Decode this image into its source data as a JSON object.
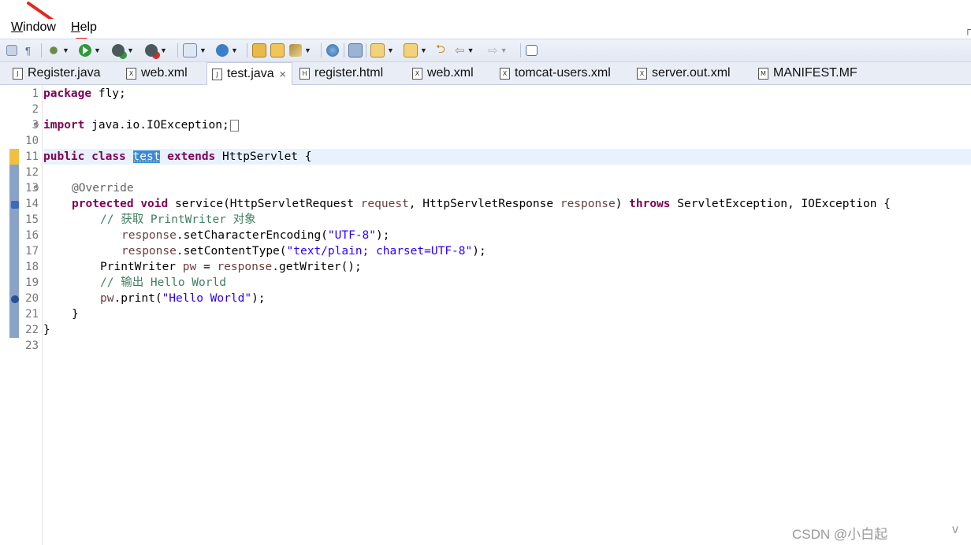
{
  "menubar": {
    "items": [
      {
        "label": "Window",
        "mnemonic": "W"
      },
      {
        "label": "Help",
        "mnemonic": "H"
      }
    ]
  },
  "toolbar": {
    "buttons": [
      {
        "name": "show-source-icon"
      },
      {
        "name": "pilcrow-icon"
      },
      {
        "name": "debug-icon"
      },
      {
        "name": "run-icon"
      },
      {
        "name": "run-server-icon"
      },
      {
        "name": "external-tools-icon"
      },
      {
        "name": "new-server-icon"
      },
      {
        "name": "new-class-icon"
      },
      {
        "name": "open-type-icon"
      },
      {
        "name": "open-folder-icon"
      },
      {
        "name": "search-icon"
      },
      {
        "name": "globe-icon"
      },
      {
        "name": "annotation-icon"
      },
      {
        "name": "next-annotation-icon"
      },
      {
        "name": "prev-annotation-icon"
      },
      {
        "name": "last-edit-icon"
      },
      {
        "name": "back-icon"
      },
      {
        "name": "forward-icon"
      },
      {
        "name": "maximize-icon"
      }
    ]
  },
  "tabs": [
    {
      "label": "Register.java",
      "icon": "J",
      "active": false
    },
    {
      "label": "web.xml",
      "icon": "X",
      "active": false
    },
    {
      "label": "test.java",
      "icon": "J",
      "active": true,
      "close": "⨯"
    },
    {
      "label": "register.html",
      "icon": "H",
      "active": false
    },
    {
      "label": "web.xml",
      "icon": "X",
      "active": false
    },
    {
      "label": "tomcat-users.xml",
      "icon": "X",
      "active": false
    },
    {
      "label": "server.out.xml",
      "icon": "X",
      "active": false
    },
    {
      "label": "MANIFEST.MF",
      "icon": "M",
      "active": false
    }
  ],
  "editor": {
    "line_numbers": [
      "1",
      "2",
      "3",
      "10",
      "11",
      "12",
      "13",
      "14",
      "15",
      "16",
      "17",
      "18",
      "19",
      "20",
      "21",
      "22",
      "23"
    ],
    "lines": {
      "l1_kw": "package",
      "l1_rest": " fly;",
      "l3_kw": "import",
      "l3_rest": " java.io.IOException;",
      "l11_kw1": "public",
      "l11_kw2": "class",
      "l11_sel": "test",
      "l11_kw3": "extends",
      "l11_rest": " HttpServlet {",
      "l13_ann": "@Override",
      "l14_kw1": "protected",
      "l14_kw2": "void",
      "l14_a": " service(HttpServletRequest ",
      "l14_p1": "request",
      "l14_b": ", HttpServletResponse ",
      "l14_p2": "response",
      "l14_c": ") ",
      "l14_kw3": "throws",
      "l14_d": " ServletException, IOException {",
      "l15_cm": "// 获取 PrintWriter 对象",
      "l16_p": "response",
      "l16_a": ".setCharacterEncoding(",
      "l16_s": "\"UTF-8\"",
      "l16_b": ");",
      "l17_p": "response",
      "l17_a": ".setContentType(",
      "l17_s": "\"text/plain; charset=UTF-8\"",
      "l17_b": ");",
      "l18_a": "PrintWriter ",
      "l18_p": "pw",
      "l18_b": " = ",
      "l18_p2": "response",
      "l18_c": ".getWriter();",
      "l19_cm": "// 输出 Hello World",
      "l20_p": "pw",
      "l20_a": ".print(",
      "l20_s": "\"Hello World\"",
      "l20_b": ");",
      "l21": "}",
      "l22": "}"
    }
  },
  "watermark": {
    "text": "CSDN @小白起",
    "tail": "v"
  },
  "misc": {
    "right_edge": "┌"
  }
}
